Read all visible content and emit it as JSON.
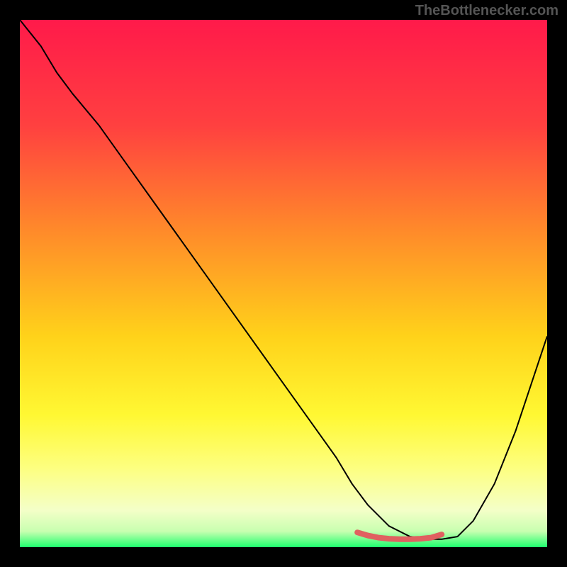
{
  "watermark": "TheBottlenecker.com",
  "chart_data": {
    "type": "line",
    "title": "",
    "xlabel": "",
    "ylabel": "",
    "xlim": [
      0,
      100
    ],
    "ylim": [
      0,
      100
    ],
    "grid": false,
    "legend": false,
    "gradient_stops": [
      {
        "offset": 0,
        "color": "#ff1a4a"
      },
      {
        "offset": 20,
        "color": "#ff4040"
      },
      {
        "offset": 40,
        "color": "#ff8a2a"
      },
      {
        "offset": 60,
        "color": "#ffd21a"
      },
      {
        "offset": 75,
        "color": "#fff833"
      },
      {
        "offset": 85,
        "color": "#fdff80"
      },
      {
        "offset": 93,
        "color": "#f4ffc8"
      },
      {
        "offset": 97,
        "color": "#c8ffb0"
      },
      {
        "offset": 100,
        "color": "#1eff6e"
      }
    ],
    "series": [
      {
        "name": "bottleneck-curve",
        "color": "#000000",
        "x": [
          0,
          4,
          7,
          10,
          15,
          20,
          25,
          30,
          35,
          40,
          45,
          50,
          55,
          60,
          63,
          66,
          70,
          74,
          78,
          80,
          83,
          86,
          90,
          94,
          100
        ],
        "y": [
          100,
          95,
          90,
          86,
          80,
          73,
          66,
          59,
          52,
          45,
          38,
          31,
          24,
          17,
          12,
          8,
          4,
          2,
          1.5,
          1.5,
          2,
          5,
          12,
          22,
          40
        ]
      },
      {
        "name": "recommended-range",
        "color": "#e06060",
        "thick": true,
        "x": [
          64,
          66,
          68,
          70,
          72,
          74,
          76,
          78,
          80
        ],
        "y": [
          2.8,
          2.2,
          1.8,
          1.6,
          1.5,
          1.5,
          1.6,
          1.8,
          2.4
        ]
      }
    ]
  }
}
